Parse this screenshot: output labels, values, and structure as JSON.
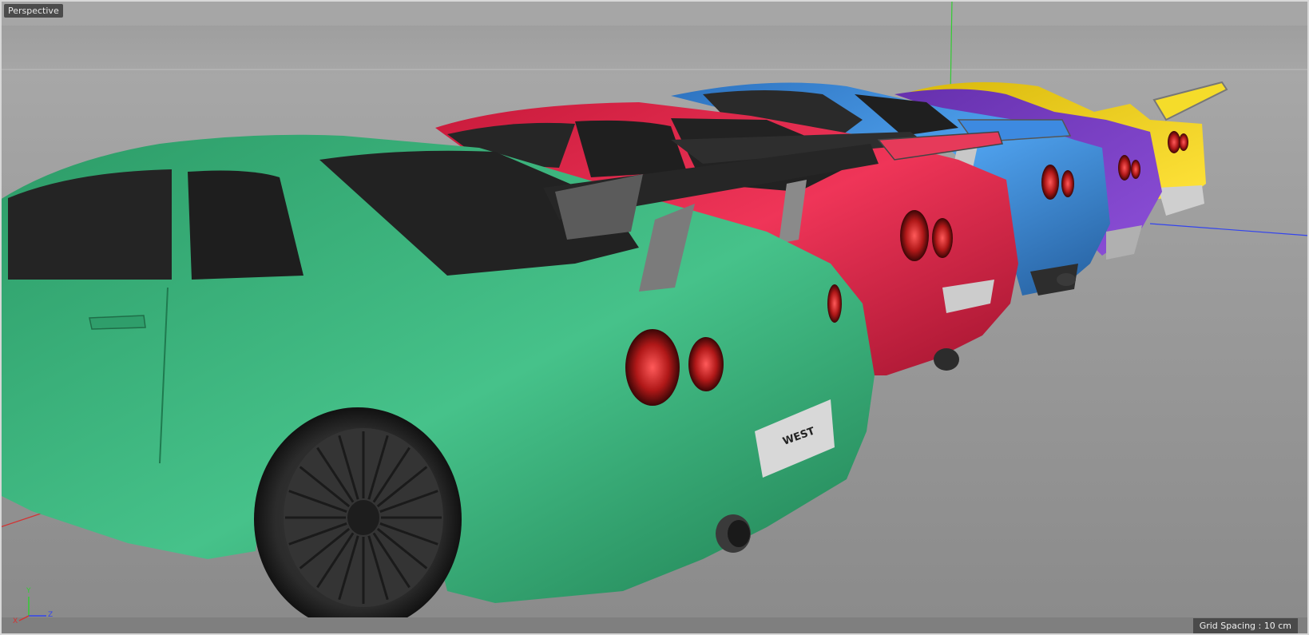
{
  "viewport": {
    "title": "Perspective",
    "grid_spacing": "Grid Spacing : 10 cm"
  },
  "gizmo": {
    "x_label": "X",
    "y_label": "Y",
    "z_label": "Z"
  },
  "scene": {
    "cars": [
      {
        "name": "green-car",
        "color": "#3fb37c"
      },
      {
        "name": "red-car",
        "color": "#e8274c"
      },
      {
        "name": "blue-car",
        "color": "#3e8bd8"
      },
      {
        "name": "purple-car",
        "color": "#7b3ec7"
      },
      {
        "name": "yellow-car",
        "color": "#f1d31a"
      }
    ],
    "plate_text": "WEST"
  },
  "colors": {
    "axis_x": "#d33333",
    "axis_y": "#33cc33",
    "axis_z": "#3344ee"
  }
}
